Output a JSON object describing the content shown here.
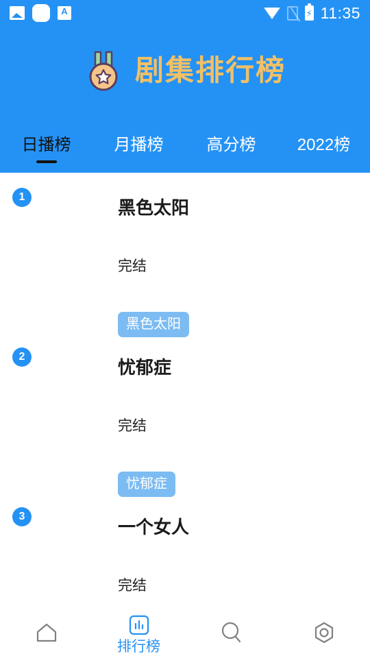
{
  "status_bar": {
    "time": "11:35",
    "left_icons": [
      "image-icon",
      "rounded-square-icon",
      "translate-icon"
    ],
    "right_icons": [
      "wifi-icon",
      "sim-disabled-icon",
      "battery-charging-icon"
    ]
  },
  "header": {
    "title": "剧集排行榜",
    "title_color": "#f2c066",
    "background_color": "#2492f5",
    "medal_icon": "medal-icon"
  },
  "tabs": {
    "active_index": 0,
    "items": [
      {
        "label": "日播榜"
      },
      {
        "label": "月播榜"
      },
      {
        "label": "高分榜"
      },
      {
        "label": "2022榜"
      }
    ]
  },
  "list": {
    "items": [
      {
        "rank": "1",
        "title": "黑色太阳",
        "status": "完结",
        "tag": "黑色太阳"
      },
      {
        "rank": "2",
        "title": "忧郁症",
        "status": "完结",
        "tag": "忧郁症"
      },
      {
        "rank": "3",
        "title": "一个女人",
        "status": "完结",
        "tag": ""
      }
    ]
  },
  "bottom_nav": {
    "active_index": 1,
    "items": [
      {
        "label": "",
        "icon": "home-icon"
      },
      {
        "label": "排行榜",
        "icon": "chart-icon"
      },
      {
        "label": "",
        "icon": "search-icon"
      },
      {
        "label": "",
        "icon": "settings-hex-icon"
      }
    ]
  },
  "colors": {
    "accent": "#2492f5",
    "tag_chip": "#7cbcf2",
    "title_gold": "#f2c066",
    "nav_inactive": "#808080"
  }
}
